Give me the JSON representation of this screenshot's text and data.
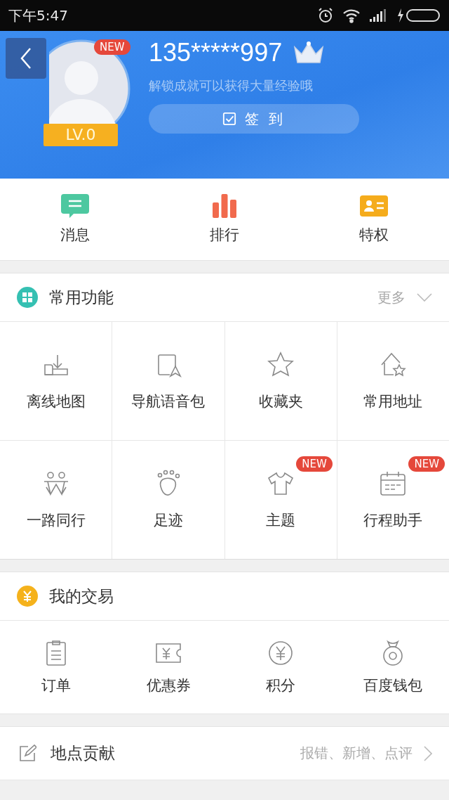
{
  "status_bar": {
    "time": "下午5:47"
  },
  "profile": {
    "avatar_badge": "NEW",
    "level": "LV.0",
    "phone": "135*****997",
    "subtitle": "解锁成就可以获得大量经验哦",
    "checkin": "签 到"
  },
  "quick_links": [
    {
      "label": "消息"
    },
    {
      "label": "排行"
    },
    {
      "label": "特权"
    }
  ],
  "common": {
    "title": "常用功能",
    "more": "更多",
    "items": [
      {
        "label": "离线地图"
      },
      {
        "label": "导航语音包"
      },
      {
        "label": "收藏夹"
      },
      {
        "label": "常用地址"
      },
      {
        "label": "一路同行"
      },
      {
        "label": "足迹"
      },
      {
        "label": "主题",
        "badge": "NEW"
      },
      {
        "label": "行程助手",
        "badge": "NEW"
      }
    ]
  },
  "trade": {
    "title": "我的交易",
    "items": [
      {
        "label": "订单"
      },
      {
        "label": "优惠券"
      },
      {
        "label": "积分"
      },
      {
        "label": "百度钱包"
      }
    ]
  },
  "list": [
    {
      "title": "地点贡献",
      "hint": "报错、新增、点评"
    }
  ]
}
